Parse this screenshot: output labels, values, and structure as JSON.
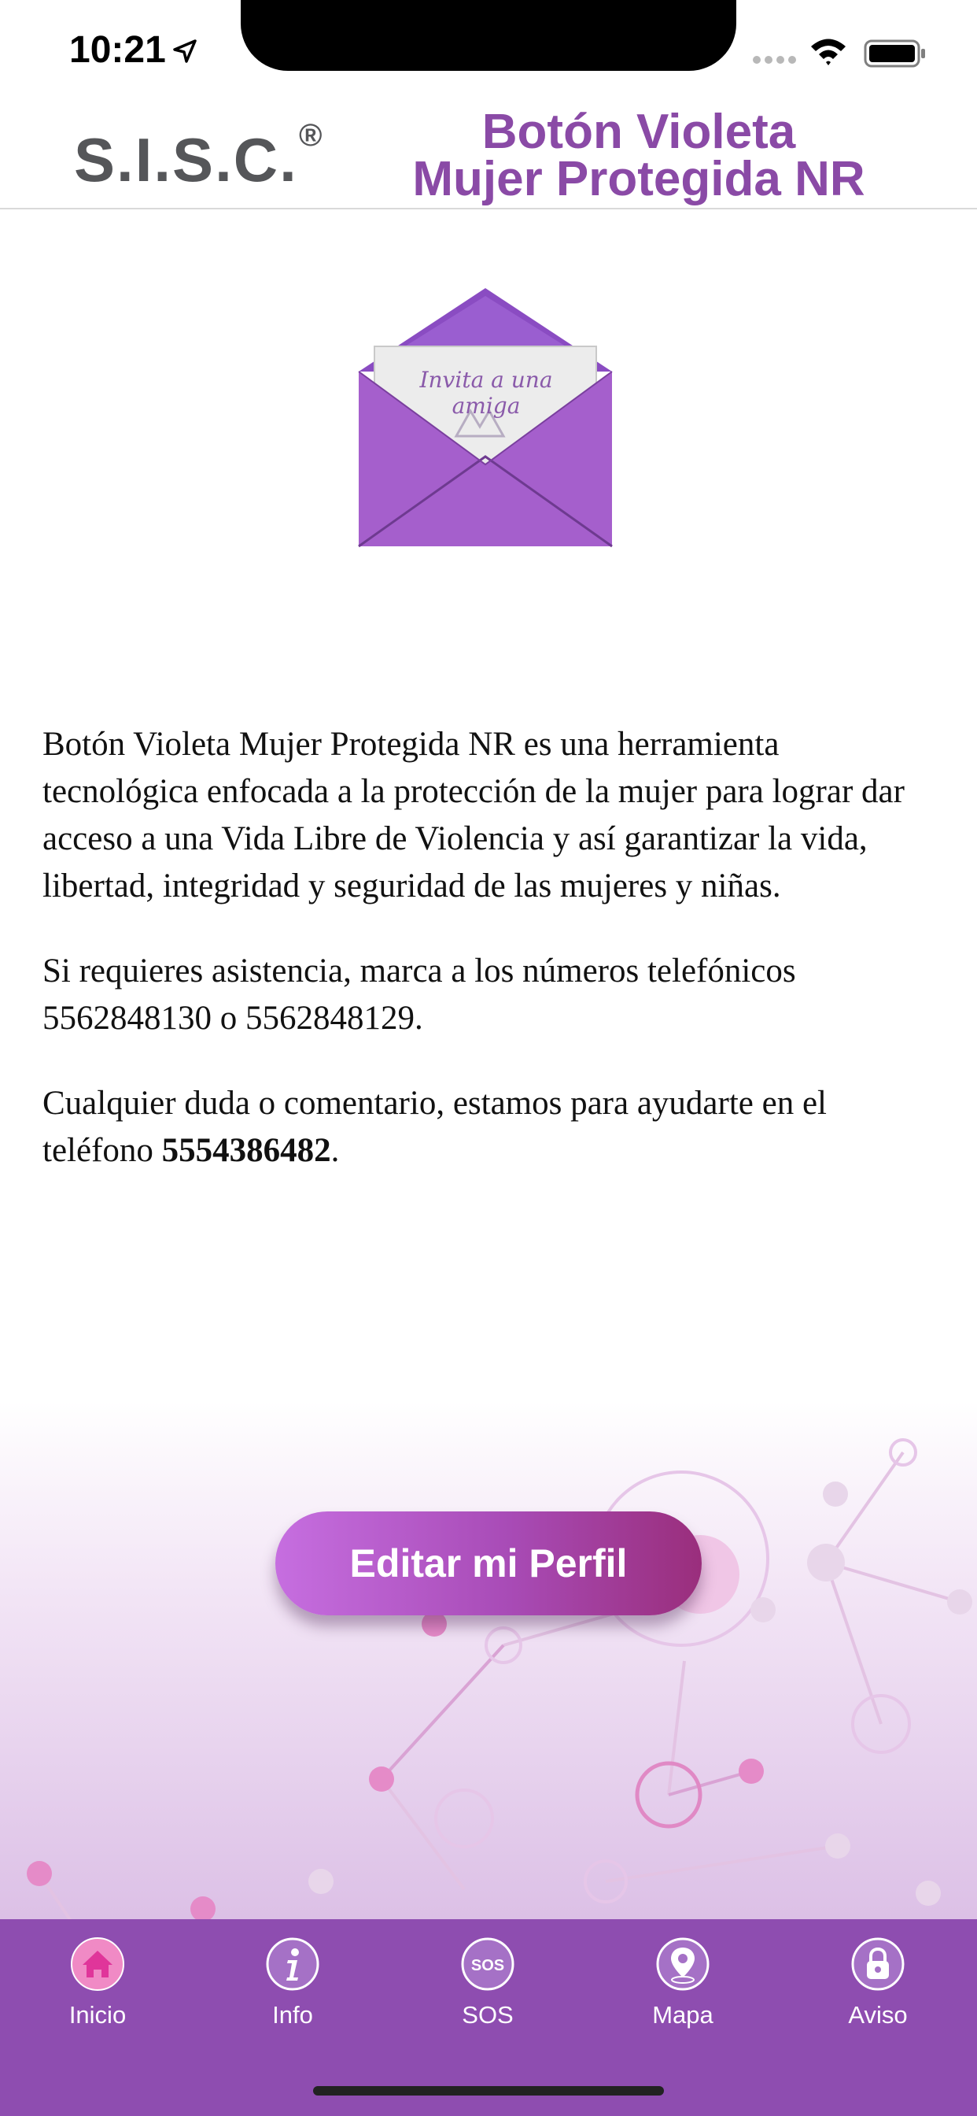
{
  "status_bar": {
    "time": "10:21"
  },
  "header": {
    "brand": "S.I.S.C.",
    "brand_mark": "®",
    "title_line1": "Botón Violeta",
    "title_line2": "Mujer Protegida NR"
  },
  "envelope": {
    "text": "Invita a una amiga"
  },
  "description": {
    "p1": "Botón Violeta Mujer Protegida NR es una herramienta tecnológica enfocada a la protección de la mujer para lograr dar acceso a una Vida Libre de Violencia y así garantizar la vida, libertad, integridad y seguridad de las mujeres y niñas.",
    "p2": "Si requieres asistencia, marca a los números telefónicos 5562848130 o 5562848129.",
    "p3_prefix": "Cualquier duda o comentario, estamos para ayudarte en el teléfono ",
    "p3_phone": "5554386482",
    "p3_suffix": "."
  },
  "actions": {
    "edit_profile": "Editar mi Perfil"
  },
  "tabs": [
    {
      "label": "Inicio",
      "icon": "home-icon",
      "active": true
    },
    {
      "label": "Info",
      "icon": "info-icon",
      "active": false
    },
    {
      "label": "SOS",
      "icon": "sos-icon",
      "active": false
    },
    {
      "label": "Mapa",
      "icon": "map-pin-icon",
      "active": false
    },
    {
      "label": "Aviso",
      "icon": "lock-icon",
      "active": false
    }
  ],
  "colors": {
    "primary": "#8e4db0",
    "accent": "#ec6fb3",
    "title": "#8a4aa6"
  }
}
